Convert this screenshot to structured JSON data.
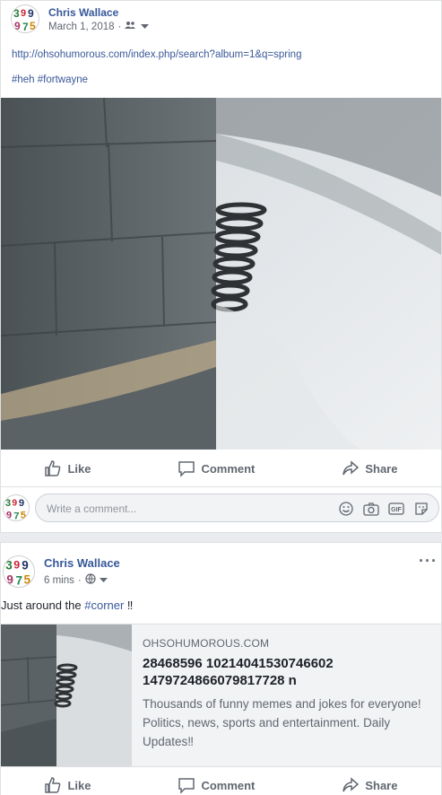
{
  "post1": {
    "author": "Chris Wallace",
    "date": "March 1, 2018",
    "privacy_icon": "friends-icon",
    "link_url": "http://ohsohumorous.com/index.php/search?album=1&q=spring",
    "hashtags": "#heh #fortwayne",
    "image_description_icon": "photo-spring-by-wall",
    "actions": {
      "like": "Like",
      "comment": "Comment",
      "share": "Share"
    },
    "comment_placeholder": "Write a comment..."
  },
  "post2": {
    "author": "Chris Wallace",
    "time": "6 mins",
    "privacy_icon": "globe-icon",
    "more": "···",
    "text_prefix": "Just around the ",
    "text_hashtag": "#corner",
    "text_suffix": " ‼",
    "preview": {
      "domain": "OHSOHUMOROUS.COM",
      "title": "28468596 10214041530746602 1479724866079817728 n",
      "description": "Thousands of funny memes and jokes for everyone! Politics, news, sports and entertainment. Daily Updates‼"
    },
    "actions": {
      "like": "Like",
      "comment": "Comment",
      "share": "Share"
    }
  },
  "colors": {
    "link": "#385898",
    "author": "#365899",
    "muted": "#606770",
    "background": "#e9ebee"
  }
}
